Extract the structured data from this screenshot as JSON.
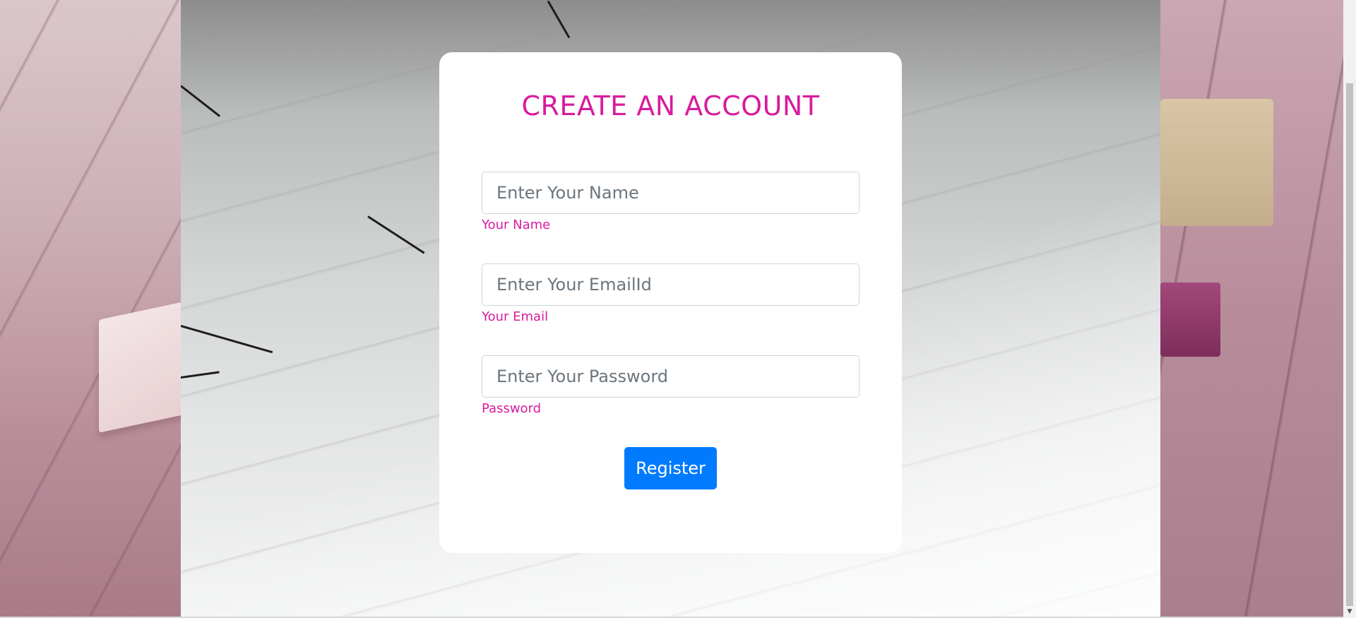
{
  "form": {
    "title": "CREATE AN ACCOUNT",
    "fields": [
      {
        "placeholder": "Enter Your Name",
        "label": "Your Name",
        "value": ""
      },
      {
        "placeholder": "Enter Your EmailId",
        "label": "Your Email",
        "value": ""
      },
      {
        "placeholder": "Enter Your Password",
        "label": "Password",
        "value": ""
      }
    ],
    "submit_label": "Register"
  },
  "colors": {
    "accent": "#d81b9e",
    "button": "#007bff",
    "card": "#ffffff"
  },
  "icons": {
    "scroll_down": "chevron-down-icon"
  }
}
